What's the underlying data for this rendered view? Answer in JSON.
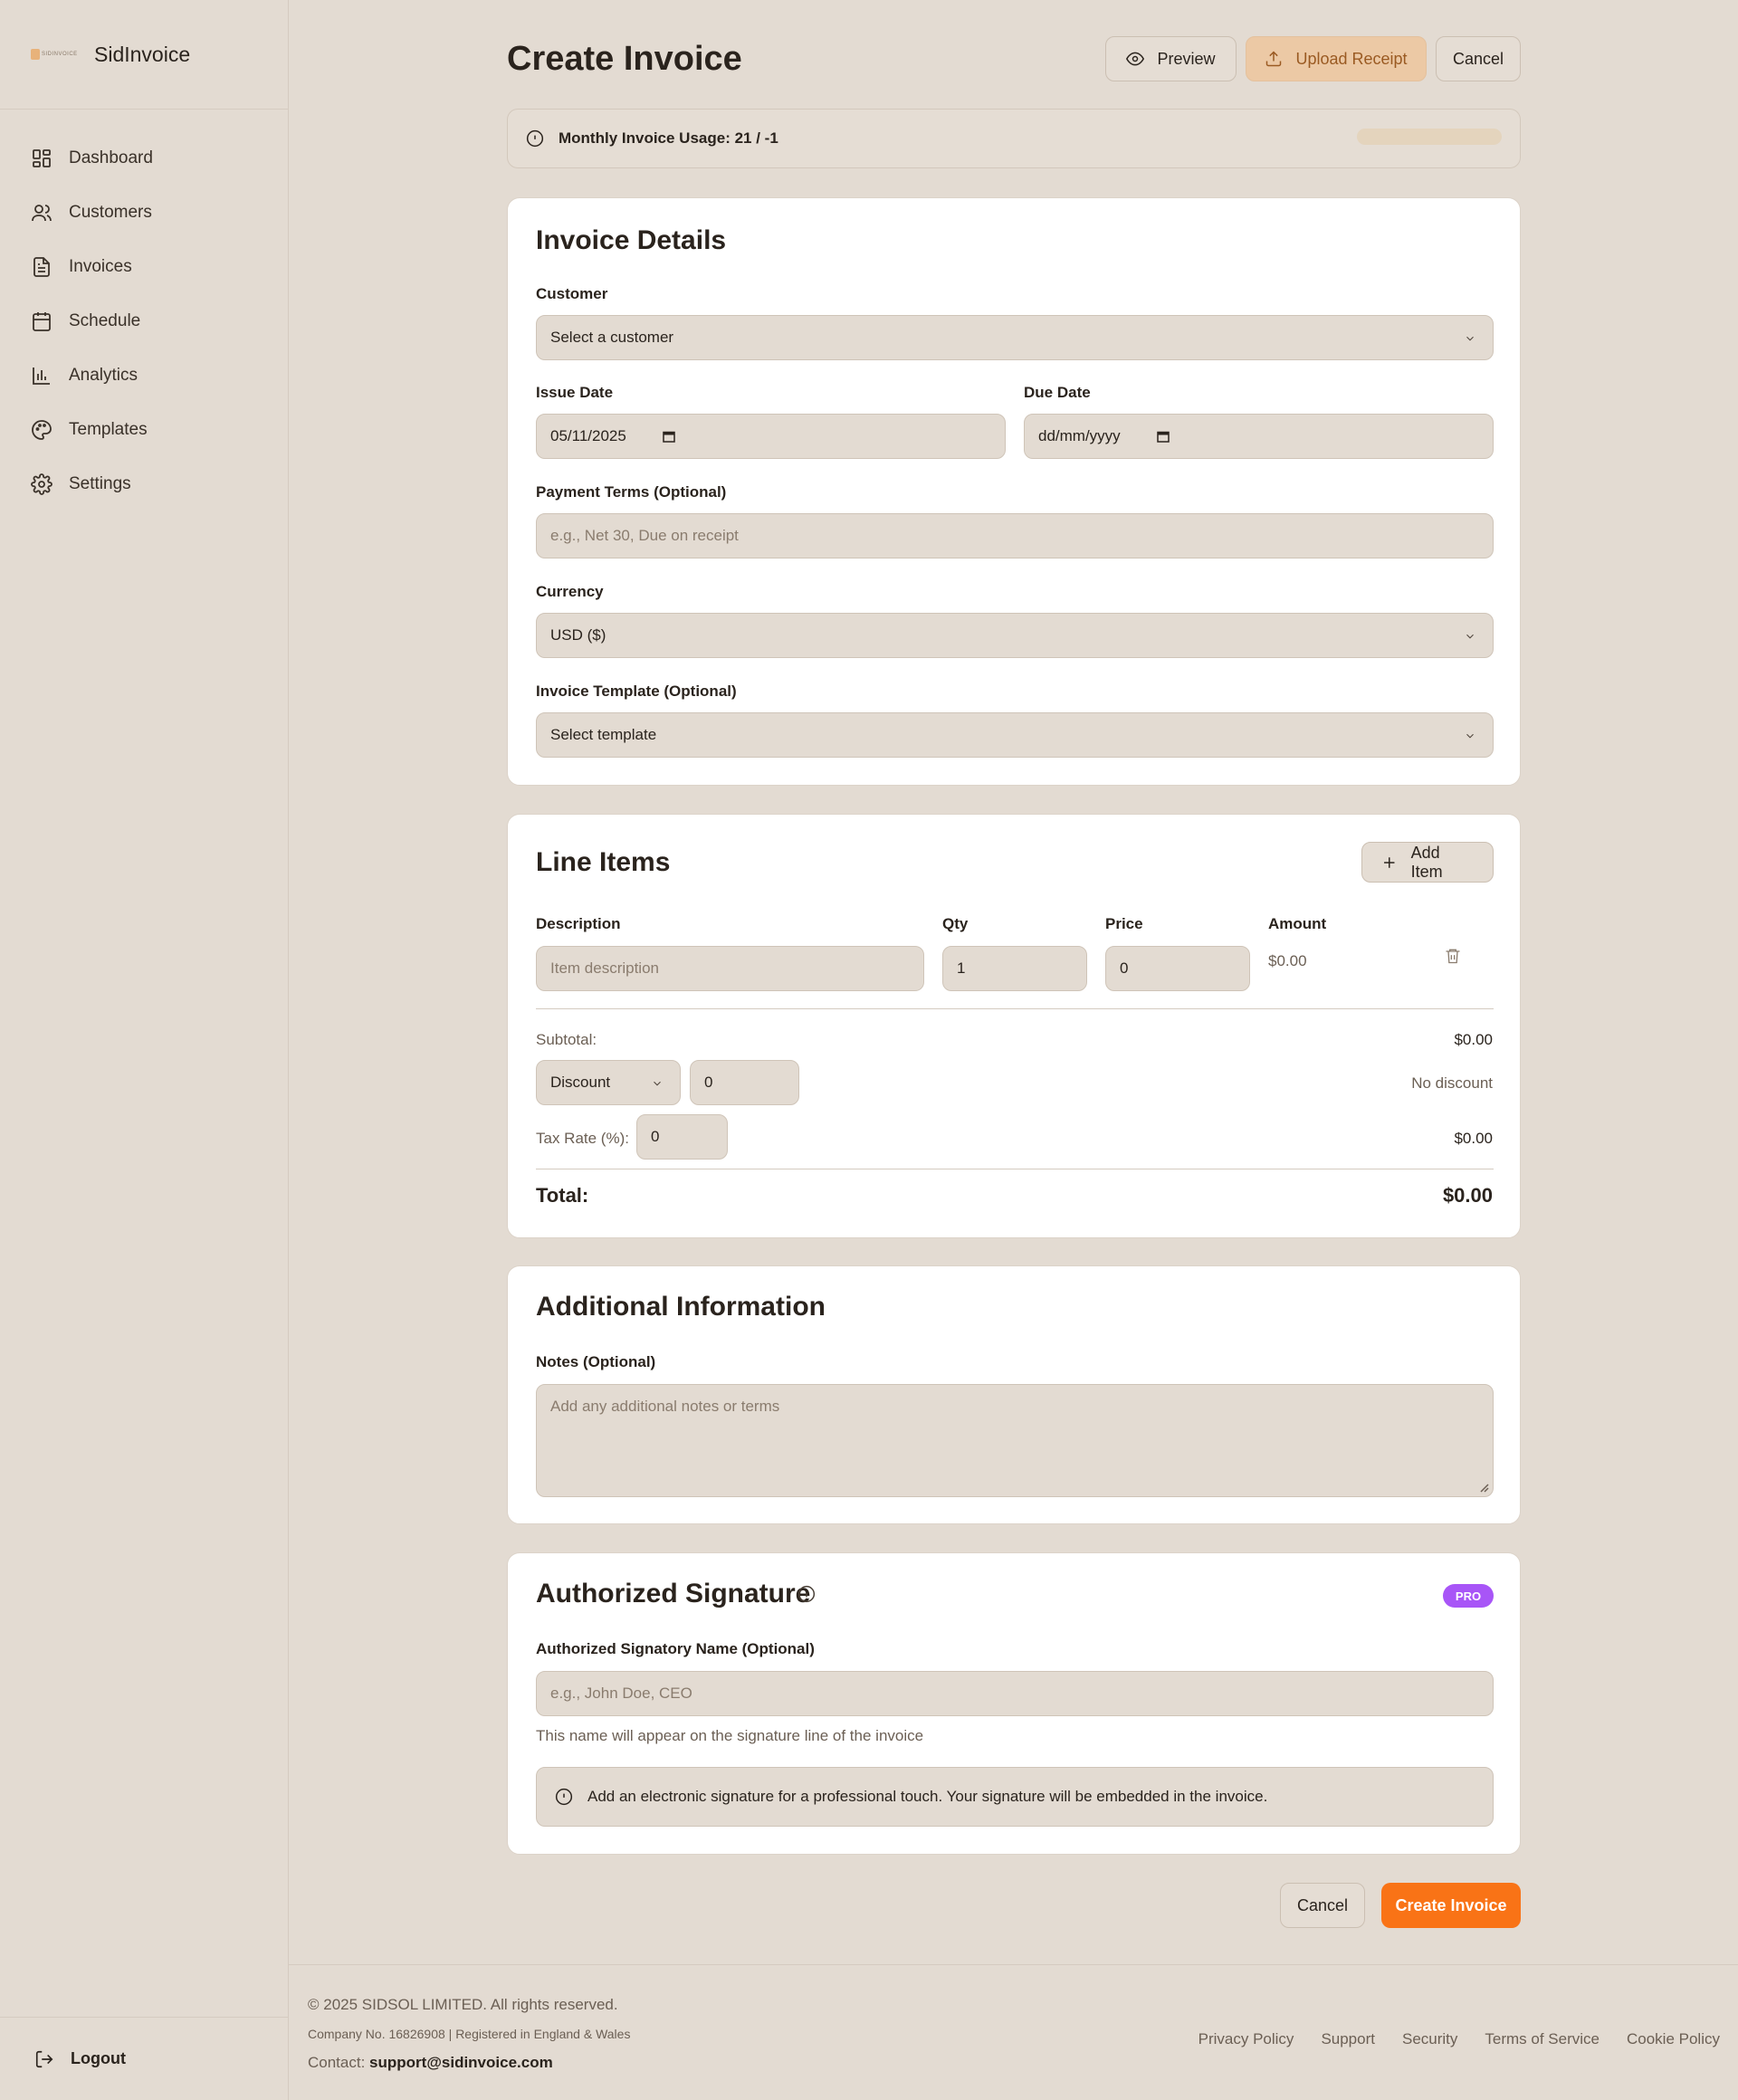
{
  "app": {
    "name": "SidInvoice",
    "logo_text": "SIDINVOICE"
  },
  "sidebar": {
    "items": [
      {
        "label": "Dashboard",
        "icon": "dashboard-icon"
      },
      {
        "label": "Customers",
        "icon": "users-icon"
      },
      {
        "label": "Invoices",
        "icon": "document-icon"
      },
      {
        "label": "Schedule",
        "icon": "calendar-icon"
      },
      {
        "label": "Analytics",
        "icon": "chart-icon"
      },
      {
        "label": "Templates",
        "icon": "palette-icon"
      },
      {
        "label": "Settings",
        "icon": "gear-icon"
      }
    ],
    "logout_label": "Logout"
  },
  "header": {
    "title": "Create Invoice",
    "preview_label": "Preview",
    "upload_label": "Upload Receipt",
    "cancel_label": "Cancel"
  },
  "usage": {
    "text": "Monthly Invoice Usage: 21 / -1"
  },
  "invoice_details": {
    "title": "Invoice Details",
    "customer_label": "Customer",
    "customer_value": "Select a customer",
    "issue_date_label": "Issue Date",
    "issue_date_value": "05/11/2025",
    "due_date_label": "Due Date",
    "due_date_value": "dd/mm/yyyy",
    "payment_terms_label": "Payment Terms (Optional)",
    "payment_terms_placeholder": "e.g., Net 30, Due on receipt",
    "currency_label": "Currency",
    "currency_value": "USD ($)",
    "template_label": "Invoice Template (Optional)",
    "template_value": "Select template"
  },
  "line_items": {
    "title": "Line Items",
    "add_label": "Add Item",
    "columns": [
      "Description",
      "Qty",
      "Price",
      "Amount"
    ],
    "row": {
      "description_placeholder": "Item description",
      "qty": "1",
      "price": "0",
      "amount": "$0.00"
    },
    "subtotal_label": "Subtotal:",
    "subtotal_value": "$0.00",
    "discount_type": "Discount",
    "discount_value": "0",
    "discount_status": "No discount",
    "tax_label": "Tax Rate (%):",
    "tax_value": "0",
    "tax_amount": "$0.00",
    "total_label": "Total:",
    "total_value": "$0.00"
  },
  "additional": {
    "title": "Additional Information",
    "notes_label": "Notes (Optional)",
    "notes_placeholder": "Add any additional notes or terms"
  },
  "signature": {
    "title": "Authorized Signature",
    "badge": "PRO",
    "name_label": "Authorized Signatory Name (Optional)",
    "name_placeholder": "e.g., John Doe, CEO",
    "help": "This name will appear on the signature line of the invoice",
    "info": "Add an electronic signature for a professional touch. Your signature will be embedded in the invoice."
  },
  "actions": {
    "cancel_label": "Cancel",
    "create_label": "Create Invoice"
  },
  "footer": {
    "copyright": "© 2025 SIDSOL LIMITED. All rights reserved.",
    "registration": "Company No. 16826908 | Registered in England & Wales",
    "contact_label": "Contact:",
    "contact_email": "support@sidinvoice.com",
    "links": [
      "Privacy Policy",
      "Support",
      "Security",
      "Terms of Service",
      "Cookie Policy"
    ]
  },
  "colors": {
    "accent": "#f97316",
    "pro_badge": "#a855f7",
    "upload_bg": "#ecc9a5",
    "background": "#e3dbd2"
  }
}
